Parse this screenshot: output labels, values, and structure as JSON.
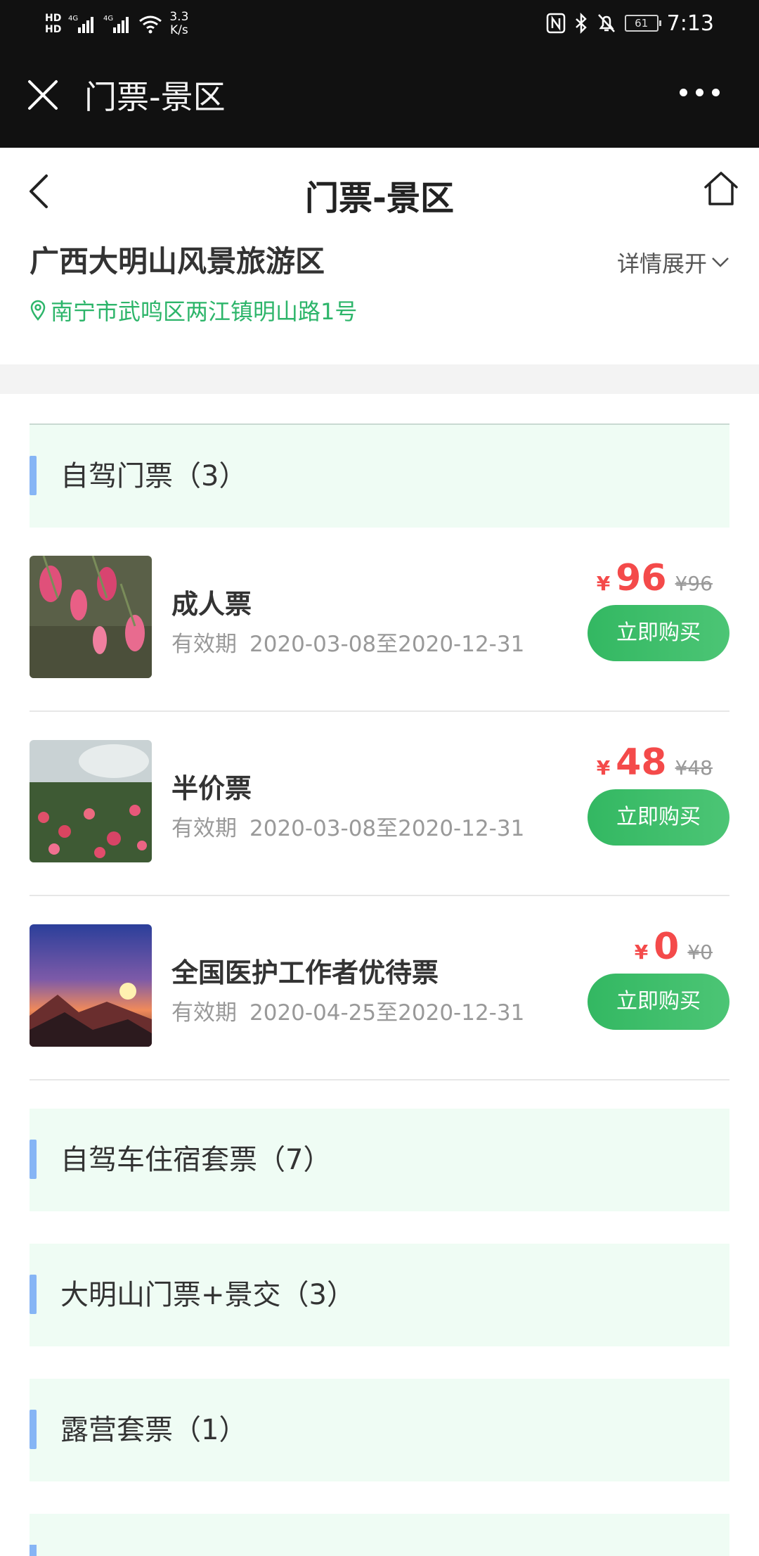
{
  "status_bar": {
    "hd1": "HD",
    "hd2": "HD",
    "net1": "4G",
    "net2": "4G",
    "speed_value": "3.3",
    "speed_unit": "K/s",
    "battery": "61",
    "time": "7:13"
  },
  "wechat_bar": {
    "title": "门票-景区"
  },
  "page_header": {
    "title": "门票-景区"
  },
  "scenic": {
    "name": "广西大明山风景旅游区",
    "detail_toggle": "详情展开",
    "address": "南宁市武鸣区两江镇明山路1号"
  },
  "categories": [
    {
      "label": "自驾门票（3）"
    },
    {
      "label": "自驾车住宿套票（7）"
    },
    {
      "label": "大明山门票+景交（3）"
    },
    {
      "label": "露营套票（1）"
    }
  ],
  "tickets": [
    {
      "name": "成人票",
      "validity_label": "有效期",
      "validity": "2020-03-08至2020-12-31",
      "currency": "¥",
      "price": "96",
      "original_price": "¥96",
      "buy_label": "立即购买"
    },
    {
      "name": "半价票",
      "validity_label": "有效期",
      "validity": "2020-03-08至2020-12-31",
      "currency": "¥",
      "price": "48",
      "original_price": "¥48",
      "buy_label": "立即购买"
    },
    {
      "name": "全国医护工作者优待票",
      "validity_label": "有效期",
      "validity": "2020-04-25至2020-12-31",
      "currency": "¥",
      "price": "0",
      "original_price": "¥0",
      "buy_label": "立即购买"
    }
  ],
  "colors": {
    "accent_green": "#33b862",
    "price_red": "#f44a4a",
    "category_bg": "#effcf4",
    "category_bar": "#86b5f5"
  }
}
